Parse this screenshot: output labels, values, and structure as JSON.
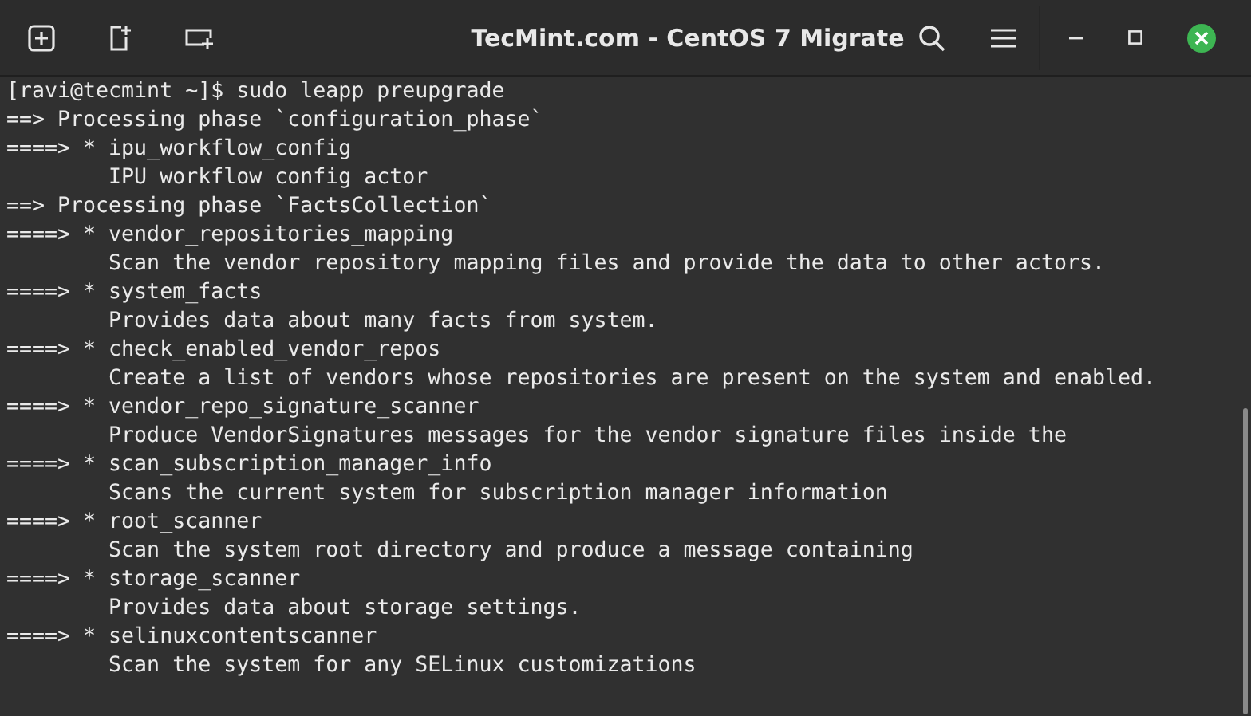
{
  "window": {
    "title": "TecMint.com - CentOS 7 Migrate"
  },
  "terminal": {
    "lines": [
      "[ravi@tecmint ~]$ sudo leapp preupgrade",
      "==> Processing phase `configuration_phase`",
      "====> * ipu_workflow_config",
      "        IPU workflow config actor",
      "==> Processing phase `FactsCollection`",
      "====> * vendor_repositories_mapping",
      "        Scan the vendor repository mapping files and provide the data to other actors.",
      "====> * system_facts",
      "        Provides data about many facts from system.",
      "====> * check_enabled_vendor_repos",
      "        Create a list of vendors whose repositories are present on the system and enabled.",
      "====> * vendor_repo_signature_scanner",
      "        Produce VendorSignatures messages for the vendor signature files inside the",
      "====> * scan_subscription_manager_info",
      "        Scans the current system for subscription manager information",
      "====> * root_scanner",
      "        Scan the system root directory and produce a message containing",
      "====> * storage_scanner",
      "        Provides data about storage settings.",
      "====> * selinuxcontentscanner",
      "        Scan the system for any SELinux customizations"
    ]
  }
}
